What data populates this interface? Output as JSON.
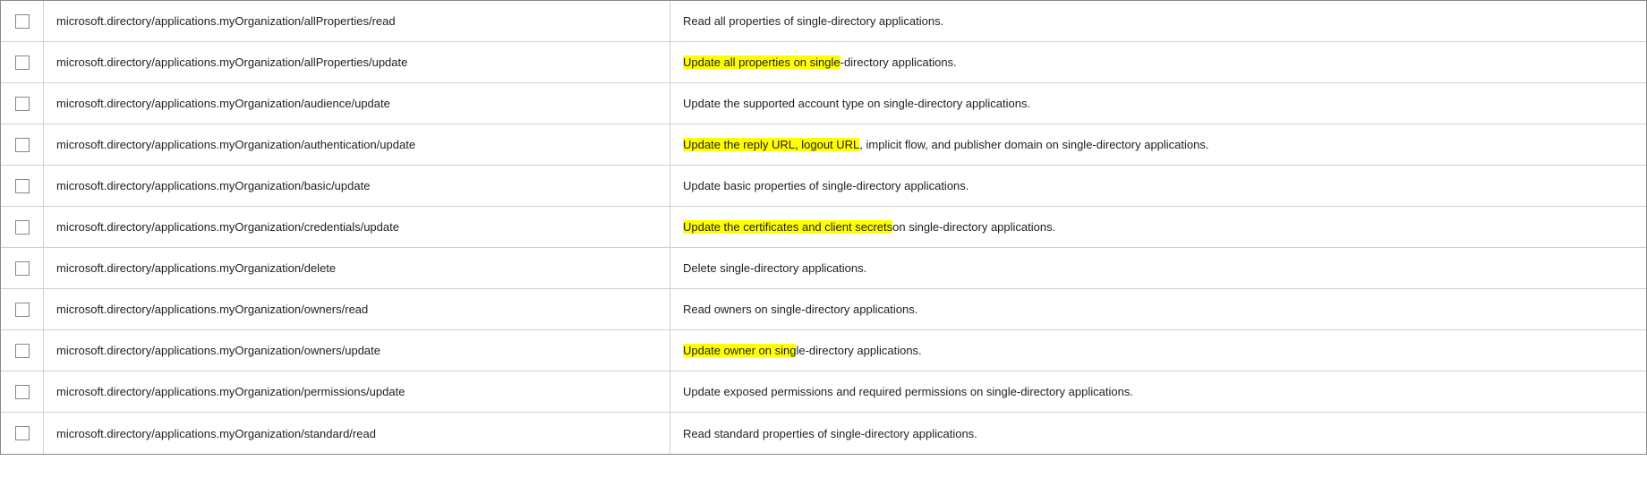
{
  "rows": [
    {
      "id": "row-allprops-read",
      "permission": "microsoft.directory/applications.myOrganization/allProperties/read",
      "description": {
        "parts": [
          {
            "text": "Read all properties of single-directory applications.",
            "highlight": false
          }
        ]
      }
    },
    {
      "id": "row-allprops-update",
      "permission": "microsoft.directory/applications.myOrganization/allProperties/update",
      "description": {
        "parts": [
          {
            "text": "Update all properties on single",
            "highlight": true
          },
          {
            "text": "-directory applications.",
            "highlight": false
          }
        ]
      }
    },
    {
      "id": "row-audience-update",
      "permission": "microsoft.directory/applications.myOrganization/audience/update",
      "description": {
        "parts": [
          {
            "text": "Update the supported account type on single-directory applications.",
            "highlight": false
          }
        ]
      }
    },
    {
      "id": "row-auth-update",
      "permission": "microsoft.directory/applications.myOrganization/authentication/update",
      "description": {
        "parts": [
          {
            "text": "Update the reply URL, logout URL",
            "highlight": true
          },
          {
            "text": ", implicit flow, and publisher domain on single-directory applications.",
            "highlight": false
          }
        ]
      }
    },
    {
      "id": "row-basic-update",
      "permission": "microsoft.directory/applications.myOrganization/basic/update",
      "description": {
        "parts": [
          {
            "text": "Update basic properties of single-directory applications.",
            "highlight": false
          }
        ]
      }
    },
    {
      "id": "row-credentials-update",
      "permission": "microsoft.directory/applications.myOrganization/credentials/update",
      "description": {
        "parts": [
          {
            "text": "Update the certificates and client secrets",
            "highlight": true
          },
          {
            "text": " on single-directory applications.",
            "highlight": false
          }
        ]
      }
    },
    {
      "id": "row-delete",
      "permission": "microsoft.directory/applications.myOrganization/delete",
      "description": {
        "parts": [
          {
            "text": "Delete single-directory applications.",
            "highlight": false
          }
        ]
      }
    },
    {
      "id": "row-owners-read",
      "permission": "microsoft.directory/applications.myOrganization/owners/read",
      "description": {
        "parts": [
          {
            "text": "Read owners on single-directory applications.",
            "highlight": false
          }
        ]
      }
    },
    {
      "id": "row-owners-update",
      "permission": "microsoft.directory/applications.myOrganization/owners/update",
      "description": {
        "parts": [
          {
            "text": "Update owner on sing",
            "highlight": true
          },
          {
            "text": "le-directory applications.",
            "highlight": false
          }
        ]
      }
    },
    {
      "id": "row-permissions-update",
      "permission": "microsoft.directory/applications.myOrganization/permissions/update",
      "description": {
        "parts": [
          {
            "text": "Update exposed permissions and required permissions on single-directory applications.",
            "highlight": false
          }
        ]
      }
    },
    {
      "id": "row-standard-read",
      "permission": "microsoft.directory/applications.myOrganization/standard/read",
      "description": {
        "parts": [
          {
            "text": "Read standard properties of single-directory applications.",
            "highlight": false
          }
        ]
      }
    }
  ]
}
